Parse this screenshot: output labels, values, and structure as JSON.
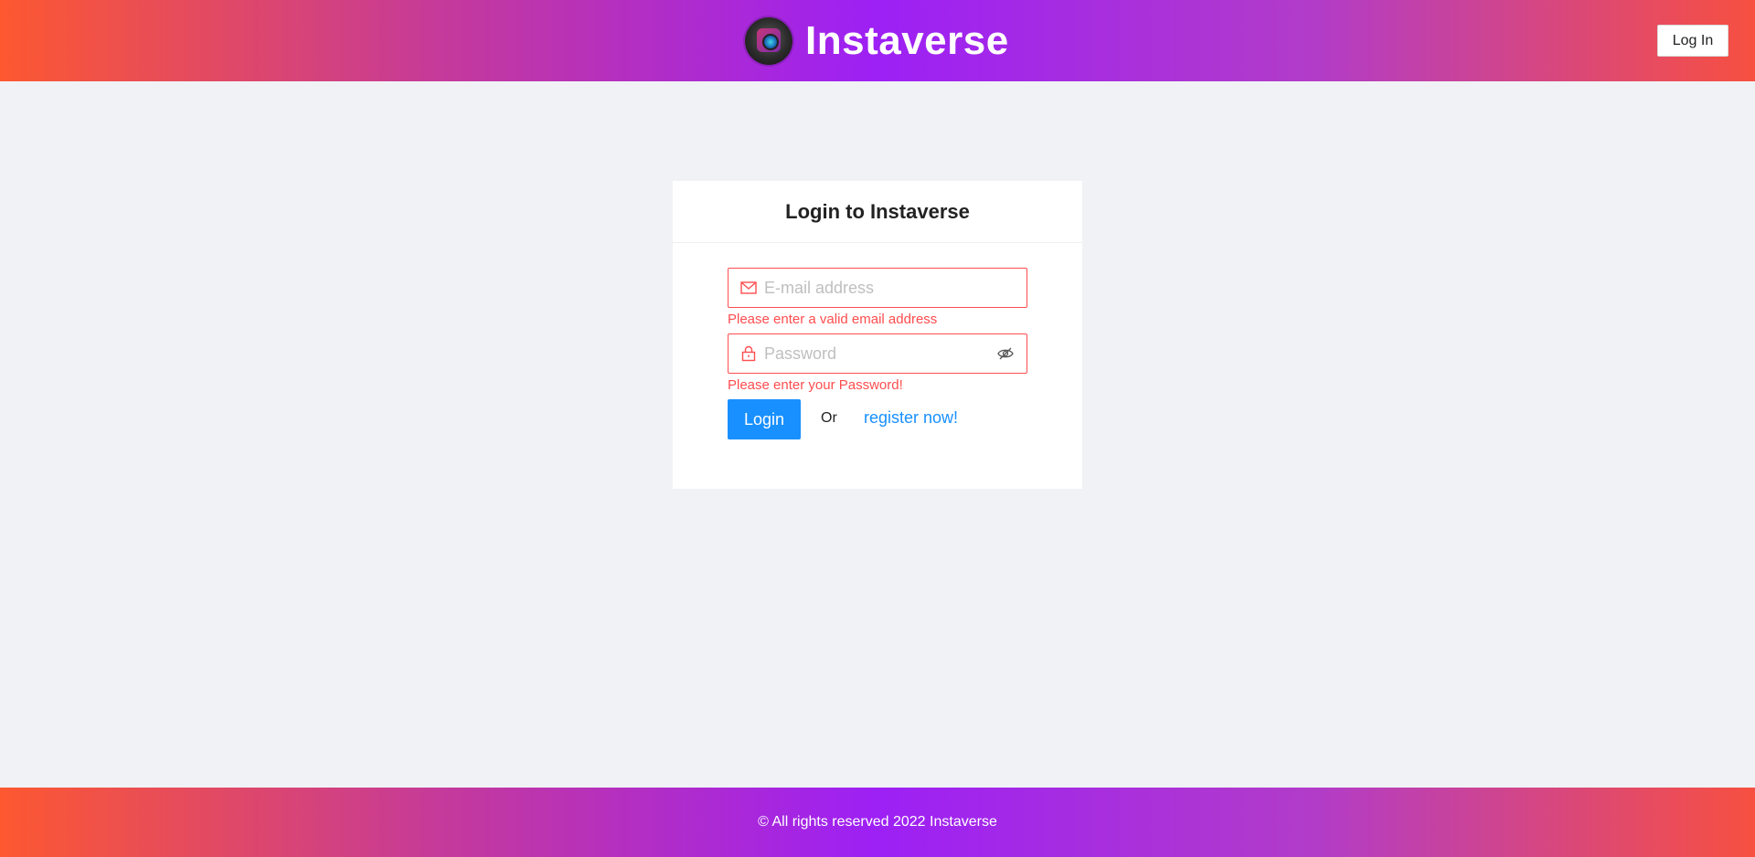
{
  "header": {
    "brand_name": "Instaverse",
    "login_button": "Log In",
    "logo_icon": "camera-logo-icon"
  },
  "login_card": {
    "title": "Login to Instaverse",
    "email": {
      "placeholder": "E-mail address",
      "value": "",
      "icon": "mail-icon",
      "error": "Please enter a valid email address"
    },
    "password": {
      "placeholder": "Password",
      "value": "",
      "icon": "lock-icon",
      "toggle_icon": "eye-invisible-icon",
      "error": "Please enter your Password!"
    },
    "submit_label": "Login",
    "or_text": "Or",
    "register_link": "register now!"
  },
  "footer": {
    "text": "© All rights reserved 2022 Instaverse"
  },
  "colors": {
    "error": "#ff4d4f",
    "primary": "#1890ff",
    "background": "#f0f2f5",
    "gradient_start": "#fd5830",
    "gradient_mid": "#9d20f5"
  }
}
